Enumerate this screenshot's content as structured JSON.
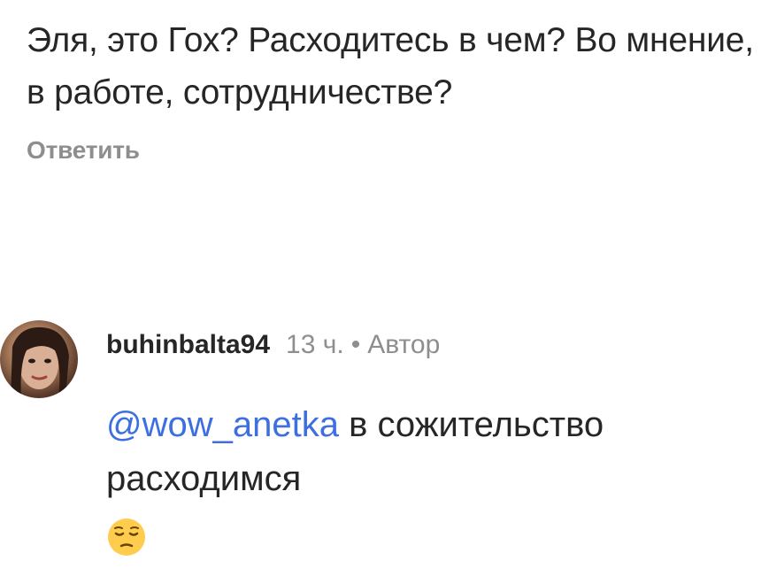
{
  "comment": {
    "text": "Эля, это Гох? Расходитесь в чем? Во мнение, в работе, сотрудничестве?",
    "reply_label": "Ответить"
  },
  "reply": {
    "username": "buhinbalta94",
    "time": "13 ч.",
    "separator": "•",
    "author_tag": "Автор",
    "mention": "@wow_anetka",
    "text": "в сожительство расходимся",
    "emoji": "pensive-face-icon",
    "colors": {
      "mention": "#3d6fe0",
      "muted": "#8e8e8e"
    }
  }
}
